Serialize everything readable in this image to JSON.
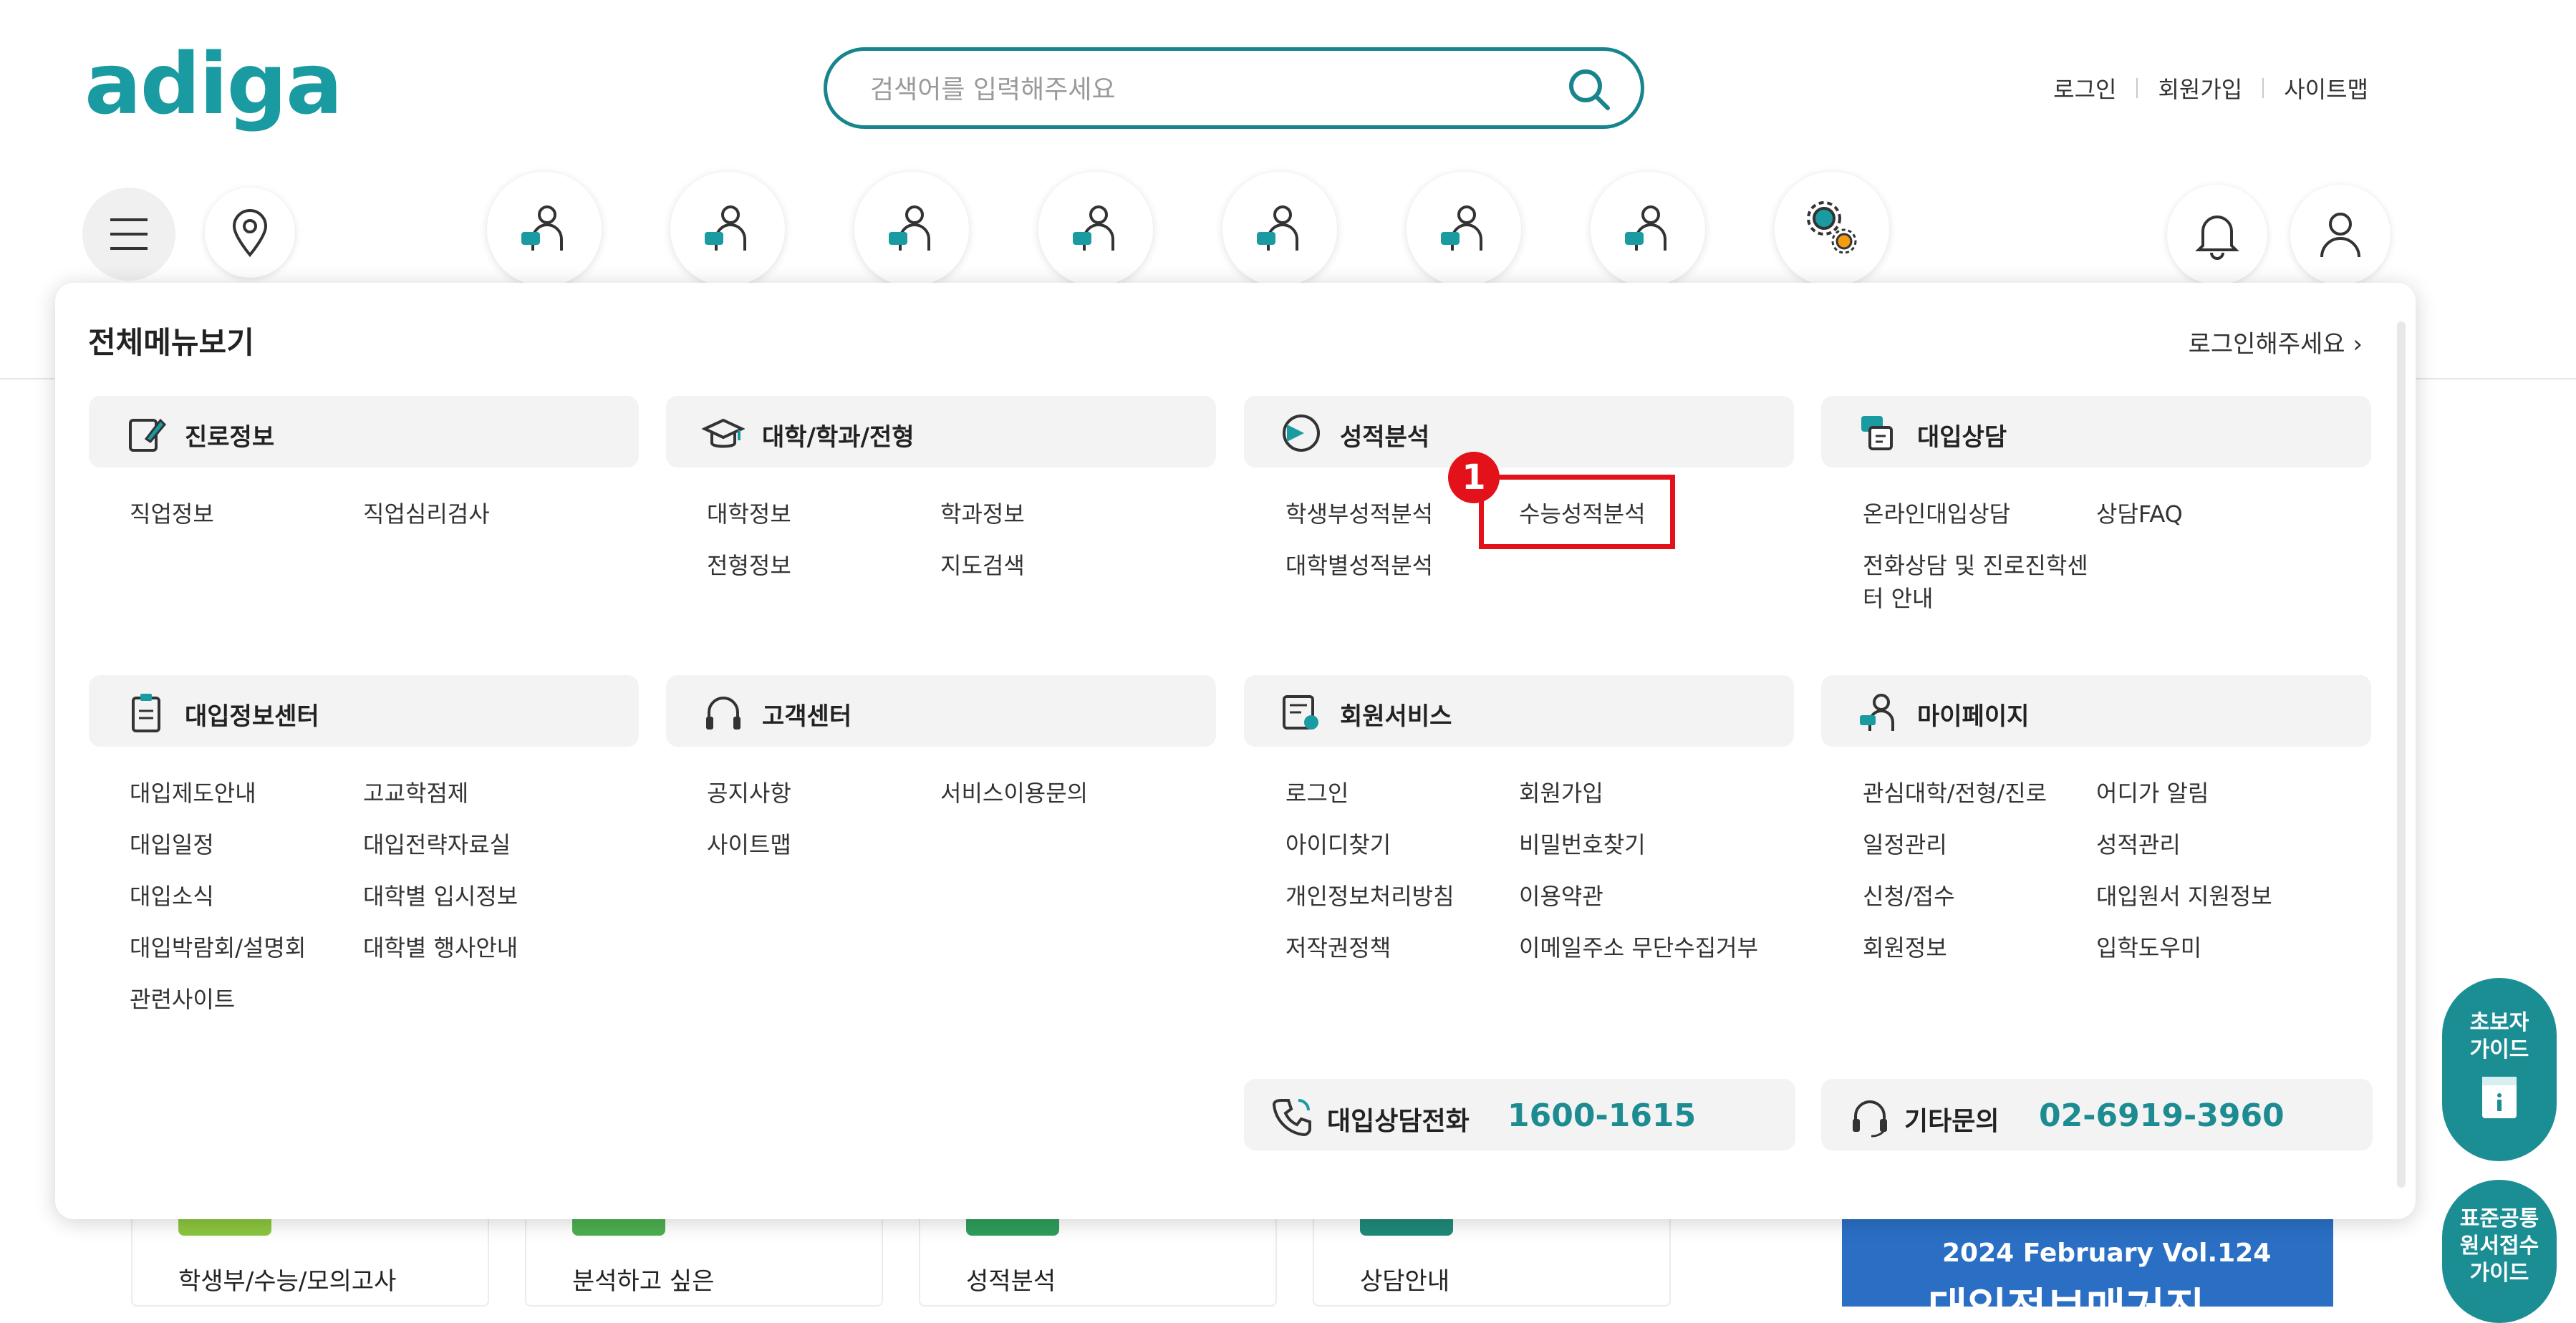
{
  "logo": "adiga",
  "search": {
    "placeholder": "검색어를 입력해주세요"
  },
  "top_links": [
    "로그인",
    "회원가입",
    "사이트맵"
  ],
  "colors": {
    "brand": "#1a9ba1",
    "accent": "#1d8c92",
    "highlight": "#e2111a"
  },
  "menu": {
    "title": "전체메뉴보기",
    "login_prompt": "로그인해주세요",
    "categories": [
      {
        "label": "진로정보",
        "icon": "career-icon",
        "items": [
          "직업정보",
          "직업심리검사"
        ]
      },
      {
        "label": "대학/학과/전형",
        "icon": "graduation-cap-icon",
        "items": [
          "대학정보",
          "학과정보",
          "전형정보",
          "지도검색"
        ]
      },
      {
        "label": "성적분석",
        "icon": "analysis-icon",
        "items": [
          "학생부성적분석",
          "수능성적분석",
          "대학별성적분석"
        ]
      },
      {
        "label": "대입상담",
        "icon": "consult-icon",
        "items": [
          "온라인대입상담",
          "상담FAQ",
          "전화상담 및 진로진학센",
          "터 안내"
        ]
      },
      {
        "label": "대입정보센터",
        "icon": "clipboard-icon",
        "items": [
          "대입제도안내",
          "고교학점제",
          "대입일정",
          "대입전략자료실",
          "대입소식",
          "대학별 입시정보",
          "대입박람회/설명회",
          "대학별 행사안내",
          "관련사이트"
        ]
      },
      {
        "label": "고객센터",
        "icon": "headset-icon",
        "items": [
          "공지사항",
          "서비스이용문의",
          "사이트맵"
        ]
      },
      {
        "label": "회원서비스",
        "icon": "member-service-icon",
        "items": [
          "로그인",
          "회원가입",
          "아이디찾기",
          "비밀번호찾기",
          "개인정보처리방침",
          "이용약관",
          "저작권정책",
          "이메일주소 무단수집거부"
        ]
      },
      {
        "label": "마이페이지",
        "icon": "mypage-icon",
        "items": [
          "관심대학/전형/진로",
          "어디가 알림",
          "일정관리",
          "성적관리",
          "신청/접수",
          "대입원서 지원정보",
          "회원정보",
          "입학도우미"
        ]
      }
    ],
    "highlight_badge": "1",
    "contacts": [
      {
        "label": "대입상담전화",
        "number": "1600-1615"
      },
      {
        "label": "기타문의",
        "number": "02-6919-3960"
      }
    ]
  },
  "side_guides": [
    {
      "line1": "초보자",
      "line2": "가이드"
    },
    {
      "line1": "표준공통",
      "line2": "원서접수",
      "line3": "가이드"
    }
  ],
  "cards": [
    "학생부/수능/모의고사",
    "분석하고 싶은",
    "성적분석",
    "상담안내"
  ],
  "magazine": {
    "line1": "2024 February Vol.124",
    "line2": "대입정보매거진"
  }
}
